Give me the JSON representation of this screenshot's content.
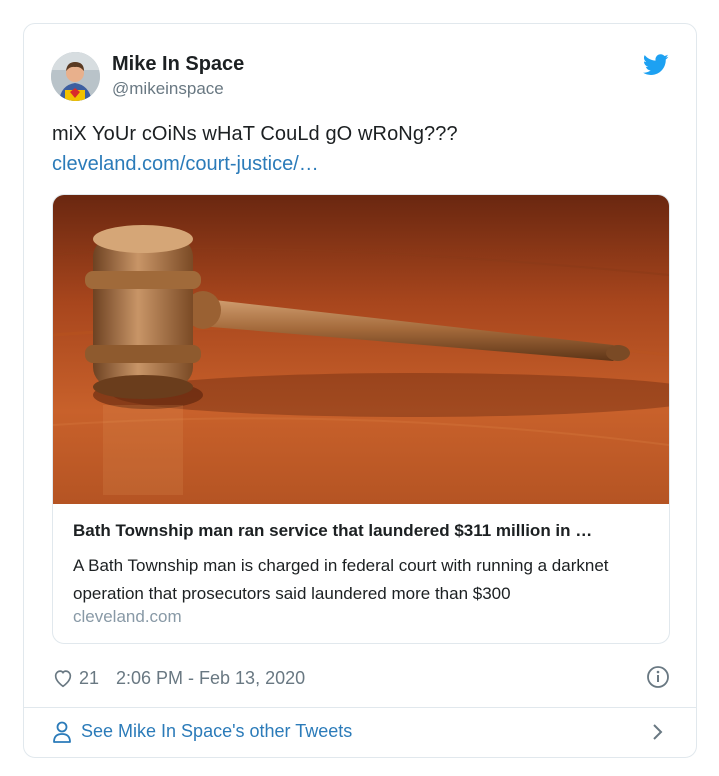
{
  "tweet": {
    "author": {
      "display_name": "Mike In Space",
      "handle": "@mikeinspace",
      "avatar_icon": "user-avatar"
    },
    "platform_icon": "twitter-bird-icon",
    "text": "miX YoUr cOiNs wHaT CouLd gO wRoNg???",
    "link_text": "cleveland.com/court-justice/…",
    "link_card": {
      "image": "gavel-photo",
      "title": "Bath Township man ran service that laundered $311 million in …",
      "description": "A Bath Township man is charged in federal court with running a darknet operation that prosecutors said laundered more than $300",
      "domain": "cleveland.com"
    },
    "likes": "21",
    "timestamp": "2:06 PM - Feb 13, 2020",
    "other_tweets_label": "See Mike In Space's other Tweets"
  },
  "colors": {
    "link": "#2b7bb9",
    "twitter_blue": "#1da1f2",
    "text": "#1c2022",
    "muted": "#697882",
    "border": "#e1e8ed"
  }
}
